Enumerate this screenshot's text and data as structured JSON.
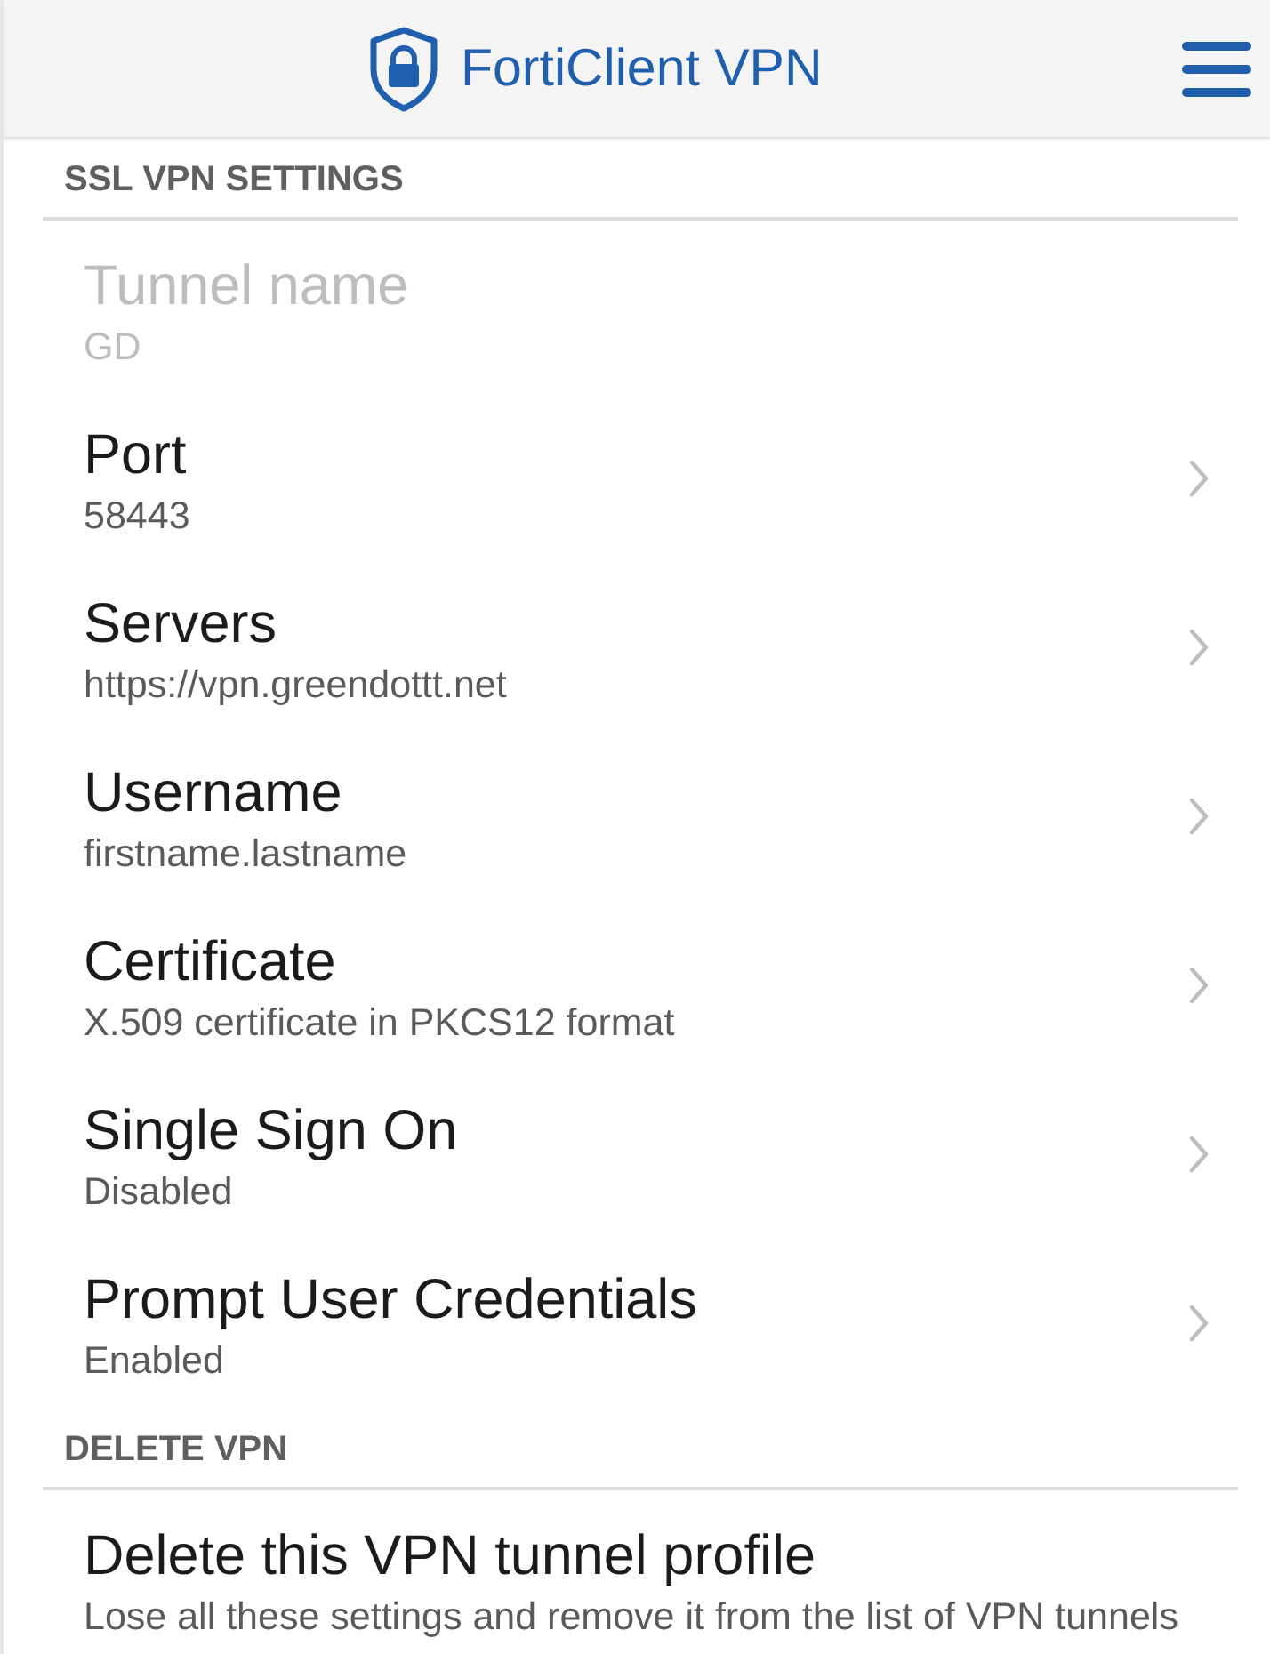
{
  "header": {
    "title": "FortiClient VPN"
  },
  "sections": [
    {
      "title": "SSL VPN SETTINGS",
      "items": [
        {
          "title": "Tunnel name",
          "value": "GD",
          "disabled": true,
          "kind": "plain"
        },
        {
          "title": "Port",
          "value": "58443",
          "disabled": false,
          "kind": "nav"
        },
        {
          "title": "Servers",
          "value": "https://vpn.greendottt.net",
          "disabled": false,
          "kind": "nav"
        },
        {
          "title": "Username",
          "value": "firstname.lastname",
          "disabled": false,
          "kind": "nav"
        },
        {
          "title": "Certificate",
          "value": "X.509 certificate in PKCS12 format",
          "disabled": false,
          "kind": "nav"
        },
        {
          "title": "Single Sign On",
          "value": "Disabled",
          "disabled": false,
          "kind": "nav"
        },
        {
          "title": "Prompt User Credentials",
          "value": "Enabled",
          "disabled": false,
          "kind": "nav"
        }
      ]
    },
    {
      "title": "DELETE VPN",
      "items": [
        {
          "title": "Delete this VPN tunnel profile",
          "value": "Lose all these settings and remove it from the list of VPN tunnels",
          "disabled": false,
          "kind": "plain"
        }
      ]
    }
  ]
}
